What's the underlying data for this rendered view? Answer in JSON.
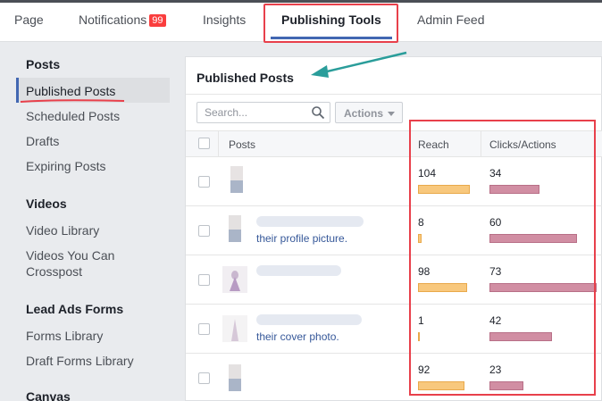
{
  "tabs": {
    "page": "Page",
    "notifications": "Notifications",
    "notifications_badge": "99",
    "insights": "Insights",
    "publishing_tools": "Publishing Tools",
    "admin_feed": "Admin Feed"
  },
  "sidebar": {
    "posts_heading": "Posts",
    "published_posts": "Published Posts",
    "scheduled_posts": "Scheduled Posts",
    "drafts": "Drafts",
    "expiring_posts": "Expiring Posts",
    "videos_heading": "Videos",
    "video_library": "Video Library",
    "videos_crosspost_line1": "Videos You Can",
    "videos_crosspost_line2": "Crosspost",
    "lead_ads_heading": "Lead Ads Forms",
    "forms_library": "Forms Library",
    "draft_forms_library": "Draft Forms Library",
    "canvas_heading": "Canvas"
  },
  "panel": {
    "title": "Published Posts",
    "search_placeholder": "Search...",
    "actions_label": "Actions"
  },
  "table": {
    "col_posts": "Posts",
    "col_reach": "Reach",
    "col_clicks": "Clicks/Actions",
    "rows": [
      {
        "caption": "",
        "reach": "104",
        "clicks": "34",
        "reach_frac": 0.72,
        "clicks_frac": 0.47
      },
      {
        "caption": "their profile picture.",
        "reach": "8",
        "clicks": "60",
        "reach_frac": 0.055,
        "clicks_frac": 0.82
      },
      {
        "caption": "",
        "reach": "98",
        "clicks": "73",
        "reach_frac": 0.68,
        "clicks_frac": 1.0
      },
      {
        "caption": "their cover photo.",
        "reach": "1",
        "clicks": "42",
        "reach_frac": 0.01,
        "clicks_frac": 0.58
      },
      {
        "caption": "",
        "reach": "92",
        "clicks": "23",
        "reach_frac": 0.64,
        "clicks_frac": 0.32
      }
    ]
  },
  "colors": {
    "reach_bar": "#f8c87d",
    "clicks_bar": "#d18ea3",
    "highlight": "#e8404b",
    "accent": "#4267b2",
    "arrow": "#2a9d9a"
  }
}
